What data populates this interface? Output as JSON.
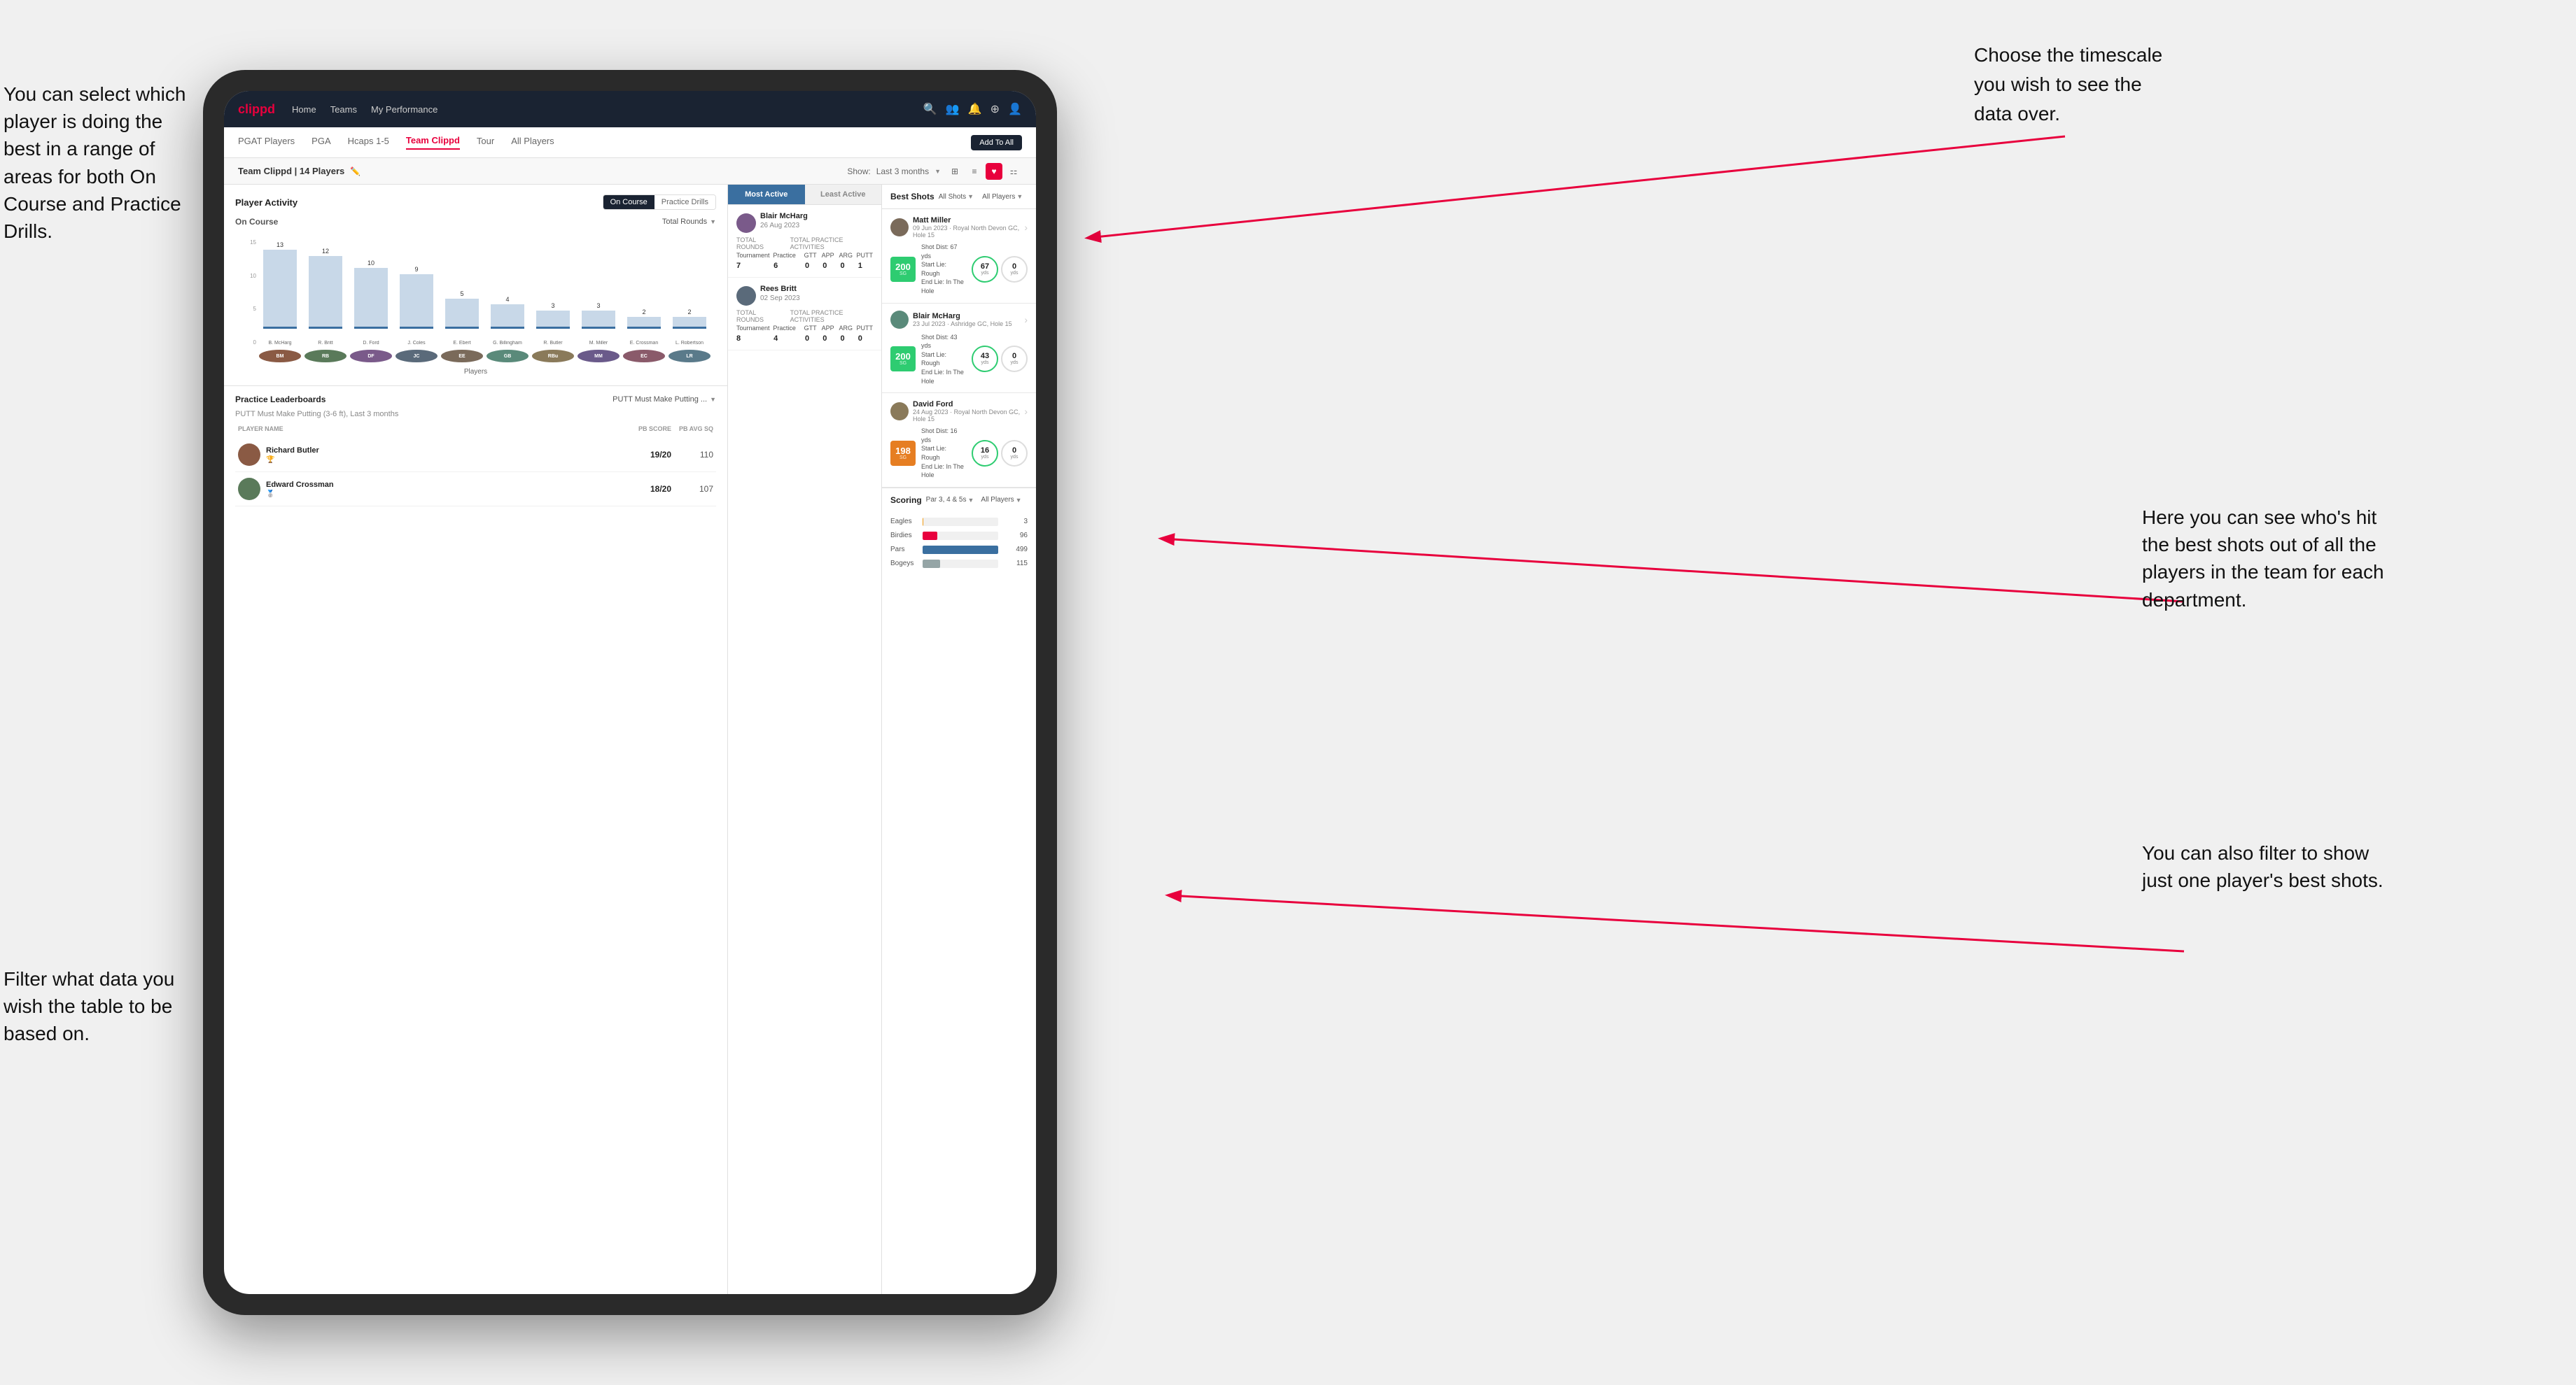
{
  "brand": {
    "name": "clippd",
    "accent_color": "#e8003d"
  },
  "nav": {
    "items": [
      "Home",
      "Teams",
      "My Performance"
    ],
    "icons": [
      "search",
      "users",
      "bell",
      "add",
      "profile"
    ]
  },
  "sub_nav": {
    "items": [
      "PGAT Players",
      "PGA",
      "Hcaps 1-5",
      "Team Clippd",
      "Tour",
      "All Players"
    ],
    "active": "Team Clippd",
    "add_button": "Add To All"
  },
  "team_header": {
    "title": "Team Clippd | 14 Players",
    "show_label": "Show:",
    "period": "Last 3 months",
    "view_options": [
      "grid",
      "list",
      "heart",
      "filter"
    ]
  },
  "player_activity": {
    "title": "Player Activity",
    "toggle_options": [
      "On Course",
      "Practice Drills"
    ],
    "active_toggle": "On Course",
    "subsection": "On Course",
    "chart_metric": "Total Rounds",
    "chart_y_axis": "Total Rounds",
    "chart_x_axis": "Players",
    "bars": [
      {
        "name": "B. McHarg",
        "value": 13,
        "initials": "BM"
      },
      {
        "name": "R. Britt",
        "value": 12,
        "initials": "RB"
      },
      {
        "name": "D. Ford",
        "value": 10,
        "initials": "DF"
      },
      {
        "name": "J. Coles",
        "value": 9,
        "initials": "JC"
      },
      {
        "name": "E. Ebert",
        "value": 5,
        "initials": "EE"
      },
      {
        "name": "G. Billingham",
        "value": 4,
        "initials": "GB"
      },
      {
        "name": "R. Butler",
        "value": 3,
        "initials": "RBu"
      },
      {
        "name": "M. Miller",
        "value": 3,
        "initials": "MM"
      },
      {
        "name": "E. Crossman",
        "value": 2,
        "initials": "EC"
      },
      {
        "name": "L. Robertson",
        "value": 2,
        "initials": "LR"
      }
    ]
  },
  "practice_leaderboards": {
    "title": "Practice Leaderboards",
    "selected_drill": "PUTT Must Make Putting ...",
    "subtitle": "PUTT Must Make Putting (3-6 ft), Last 3 months",
    "columns": [
      "PLAYER NAME",
      "PB SCORE",
      "PB AVG SQ"
    ],
    "rows": [
      {
        "name": "Richard Butler",
        "rank": 1,
        "medal": "🏆",
        "pb_score": "19/20",
        "pb_avg": "110"
      },
      {
        "name": "Edward Crossman",
        "rank": 2,
        "medal": "🥈",
        "pb_score": "18/20",
        "pb_avg": "107"
      }
    ]
  },
  "most_active": {
    "tabs": [
      "Most Active",
      "Least Active"
    ],
    "active_tab": "Most Active",
    "players": [
      {
        "name": "Blair McHarg",
        "date": "26 Aug 2023",
        "total_rounds_label": "Total Rounds",
        "tournament": "7",
        "practice": "6",
        "total_practice_label": "Total Practice Activities",
        "gtt": "0",
        "app": "0",
        "arg": "0",
        "putt": "1"
      },
      {
        "name": "Rees Britt",
        "date": "02 Sep 2023",
        "total_rounds_label": "Total Rounds",
        "tournament": "8",
        "practice": "4",
        "total_practice_label": "Total Practice Activities",
        "gtt": "0",
        "app": "0",
        "arg": "0",
        "putt": "0"
      }
    ]
  },
  "best_shots": {
    "title": "Best Shots",
    "filter1": "All Shots",
    "filter2": "All Players",
    "shots": [
      {
        "player": "Matt Miller",
        "date": "09 Jun 2023",
        "course": "Royal North Devon GC",
        "hole": "Hole 15",
        "badge_num": "200",
        "badge_label": "SG",
        "badge_color": "#2ecc71",
        "description": "Shot Dist: 67 yds\nStart Lie: Rough\nEnd Lie: In The Hole",
        "metric1_val": "67",
        "metric1_label": "yds",
        "metric2_val": "0",
        "metric2_label": "yds"
      },
      {
        "player": "Blair McHarg",
        "date": "23 Jul 2023",
        "course": "Ashridge GC",
        "hole": "Hole 15",
        "badge_num": "200",
        "badge_label": "SG",
        "badge_color": "#2ecc71",
        "description": "Shot Dist: 43 yds\nStart Lie: Rough\nEnd Lie: In The Hole",
        "metric1_val": "43",
        "metric1_label": "yds",
        "metric2_val": "0",
        "metric2_label": "yds"
      },
      {
        "player": "David Ford",
        "date": "24 Aug 2023",
        "course": "Royal North Devon GC",
        "hole": "Hole 15",
        "badge_num": "198",
        "badge_label": "SG",
        "badge_color": "#e67e22",
        "description": "Shot Dist: 16 yds\nStart Lie: Rough\nEnd Lie: In The Hole",
        "metric1_val": "16",
        "metric1_label": "yds",
        "metric2_val": "0",
        "metric2_label": "yds"
      }
    ]
  },
  "scoring": {
    "title": "Scoring",
    "filter1": "Par 3, 4 & 5s",
    "filter2": "All Players",
    "rows": [
      {
        "label": "Eagles",
        "value": 3,
        "max": 500,
        "color": "#f39c12"
      },
      {
        "label": "Birdies",
        "value": 96,
        "max": 500,
        "color": "#e8003d"
      },
      {
        "label": "Pars",
        "value": 499,
        "max": 500,
        "color": "#3a6fa0"
      },
      {
        "label": "Bogeys",
        "value": 115,
        "max": 500,
        "color": "#95a5a6"
      }
    ]
  },
  "annotations": {
    "top_right": "Choose the timescale you\nwish to see the data over.",
    "top_left": "You can select which player is\ndoing the best in a range of\nareas for both On Course and\nPractice Drills.",
    "bottom_left": "Filter what data you wish the\ntable to be based on.",
    "middle_right": "Here you can see who's hit\nthe best shots out of all the\nplayers in the team for\neach department.",
    "bottom_right": "You can also filter to show\njust one player's best shots."
  }
}
